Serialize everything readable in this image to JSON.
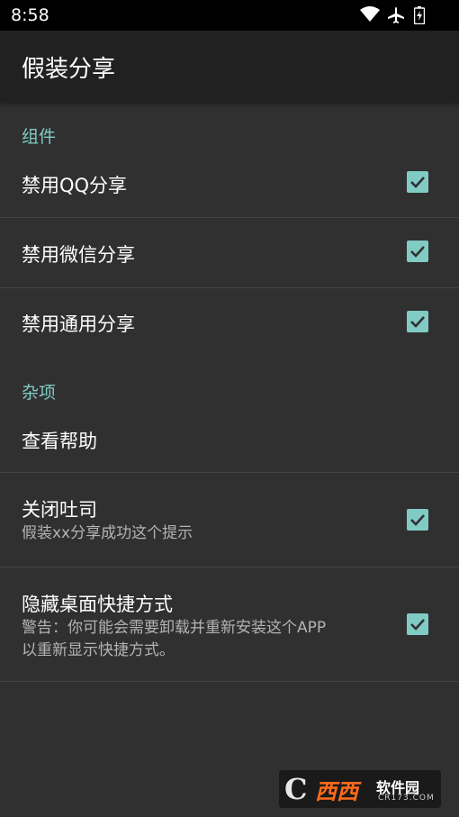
{
  "status_bar": {
    "time": "8:58",
    "icons": [
      "wifi-icon",
      "airplane-mode-icon",
      "battery-charging-icon"
    ]
  },
  "app_bar": {
    "title": "假装分享"
  },
  "sections": [
    {
      "category": "组件",
      "items": [
        {
          "title": "禁用QQ分享",
          "checked": true
        },
        {
          "title": "禁用微信分享",
          "checked": true
        },
        {
          "title": "禁用通用分享",
          "checked": true
        }
      ]
    },
    {
      "category": "杂项",
      "items": [
        {
          "title": "查看帮助"
        },
        {
          "title": "关闭吐司",
          "summary": "假装xx分享成功这个提示",
          "checked": true
        },
        {
          "title": "隐藏桌面快捷方式",
          "summary_lines": [
            "警告：你可能会需要卸载并重新安装这个APP",
            "以重新显示快捷方式。"
          ],
          "checked": true
        }
      ]
    }
  ],
  "watermark": {
    "logo_letter": "C",
    "main": "西西",
    "sub": "软件园",
    "domain": "CR173.COM"
  },
  "colors": {
    "background": "#303030",
    "app_bar": "#212121",
    "status_bar": "#000000",
    "accent": "#80cbc4",
    "divider": "#444444",
    "summary_text": "#b3b3b3"
  }
}
